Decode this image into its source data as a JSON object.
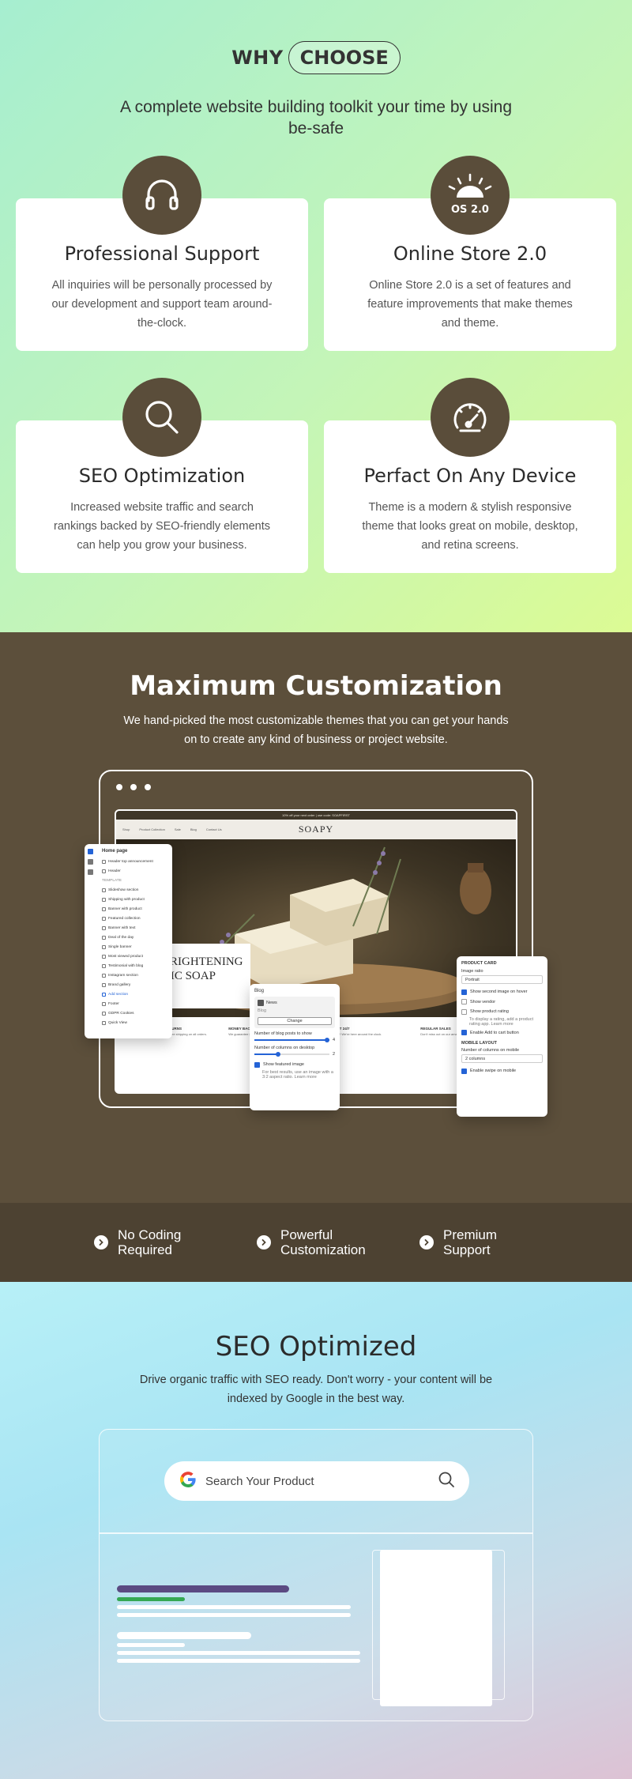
{
  "why": {
    "title_plain": "WHY",
    "title_pill": "CHOOSE",
    "subtitle": "A complete website building toolkit your time by using be-safe",
    "cards": [
      {
        "title": "Professional Support",
        "text": "All inquiries will be personally processed by our development and support team around-the-clock.",
        "icon": "headphones-icon"
      },
      {
        "title": "Online Store 2.0",
        "text": "Online Store 2.0 is a set of features and feature improvements that make themes and theme.",
        "icon": "sunrise-icon",
        "badge_text": "OS 2.0"
      },
      {
        "title": "SEO Optimization",
        "text": "Increased website traffic and search rankings backed by SEO-friendly elements can help you grow your business.",
        "icon": "search-icon"
      },
      {
        "title": "Perfact On Any Device",
        "text": "Theme is a modern & stylish responsive theme that looks great on mobile, desktop, and retina screens.",
        "icon": "speedometer-icon"
      }
    ]
  },
  "maxc": {
    "title": "Maximum Customization",
    "subtitle": "We hand-picked the most customizable themes that you can get your hands on to create any kind of business or project website.",
    "site": {
      "announcement": "10% off your next order | use code: SOAPFIRST",
      "nav": [
        "Shop",
        "Product Collection",
        "Sale",
        "Blog",
        "Contact Us"
      ],
      "brand": "SOAPY",
      "hero_text": "BRIGHTENING NIC SOAP",
      "features": [
        {
          "title": "FREE SHIPPING & RETURNS",
          "text": "Shop with confidence and free shipping on all orders."
        },
        {
          "title": "MONEY BACK",
          "text": "We guarantee your money back."
        },
        {
          "title": "SUPPORT 24/7",
          "text": "Need help? We're here around the clock."
        },
        {
          "title": "REGULAR SALES",
          "text": "Don't miss out on our amazing deals."
        }
      ]
    },
    "editor": {
      "title": "Home page",
      "items": [
        "Header top announcement",
        "Header",
        "TEMPLATE",
        "Slideshow section",
        "Shipping with product",
        "Banner with product",
        "Featured collection",
        "Banner with text",
        "Deal of the day",
        "Single banner",
        "Most viewed product",
        "Testimonial with blog",
        "Instagram section",
        "Brand gallery",
        "Add section",
        "Footer",
        "GDPR Cookies",
        "Quick View"
      ]
    },
    "blog_panel": {
      "title": "Blog",
      "blog_name": "News",
      "blog_label": "Blog",
      "change": "Change",
      "posts_label": "Number of blog posts to show",
      "posts_value": "4",
      "columns_label": "Number of columns on desktop",
      "columns_value": "2",
      "show_image": "Show featured image",
      "hint": "For best results, use an image with a 3:2 aspect ratio. Learn more"
    },
    "product_panel": {
      "title": "PRODUCT CARD",
      "ratio_label": "Image ratio",
      "ratio_value": "Portrait",
      "opt1": "Show second image on hover",
      "opt2": "Show vendor",
      "opt3": "Show product rating",
      "opt3_hint": "To display a rating, add a product rating app. Learn more",
      "opt4": "Enable Add to cart button",
      "mobile_title": "MOBILE LAYOUT",
      "mobile_cols_label": "Number of columns on mobile",
      "mobile_cols_value": "2 columns",
      "opt5": "Enable swipe on mobile"
    }
  },
  "features_bar": {
    "items": [
      "No Coding Required",
      "Powerful Customization",
      "Premium Support"
    ]
  },
  "seo": {
    "title": "SEO Optimized",
    "subtitle": "Drive organic traffic with SEO ready.  Don't worry - your content will be indexed by Google in the best way.",
    "search_placeholder": "Search Your Product",
    "colors": {
      "title_bar": "#5b4a82",
      "url_bar": "#35a853"
    }
  }
}
